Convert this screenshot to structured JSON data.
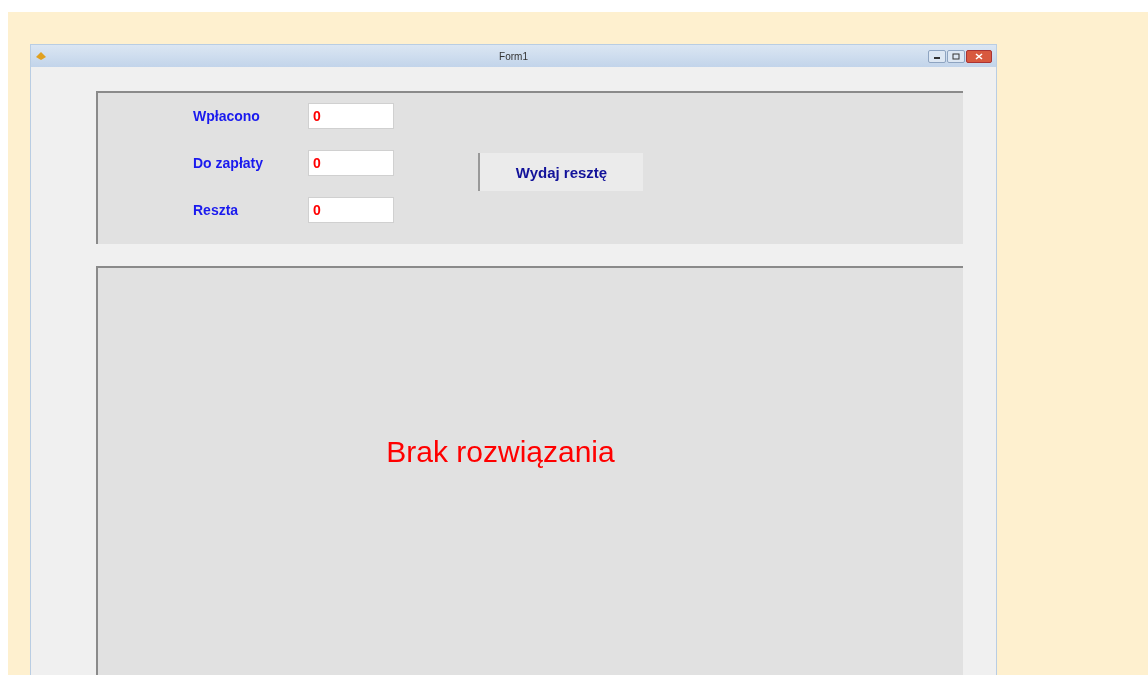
{
  "window": {
    "title": "Form1"
  },
  "fields": [
    {
      "label": "Wpłacono",
      "value": "0"
    },
    {
      "label": "Do zapłaty",
      "value": "0"
    },
    {
      "label": "Reszta",
      "value": "0"
    }
  ],
  "button": {
    "label": "Wydaj resztę"
  },
  "result": {
    "text": "Brak rozwiązania"
  }
}
